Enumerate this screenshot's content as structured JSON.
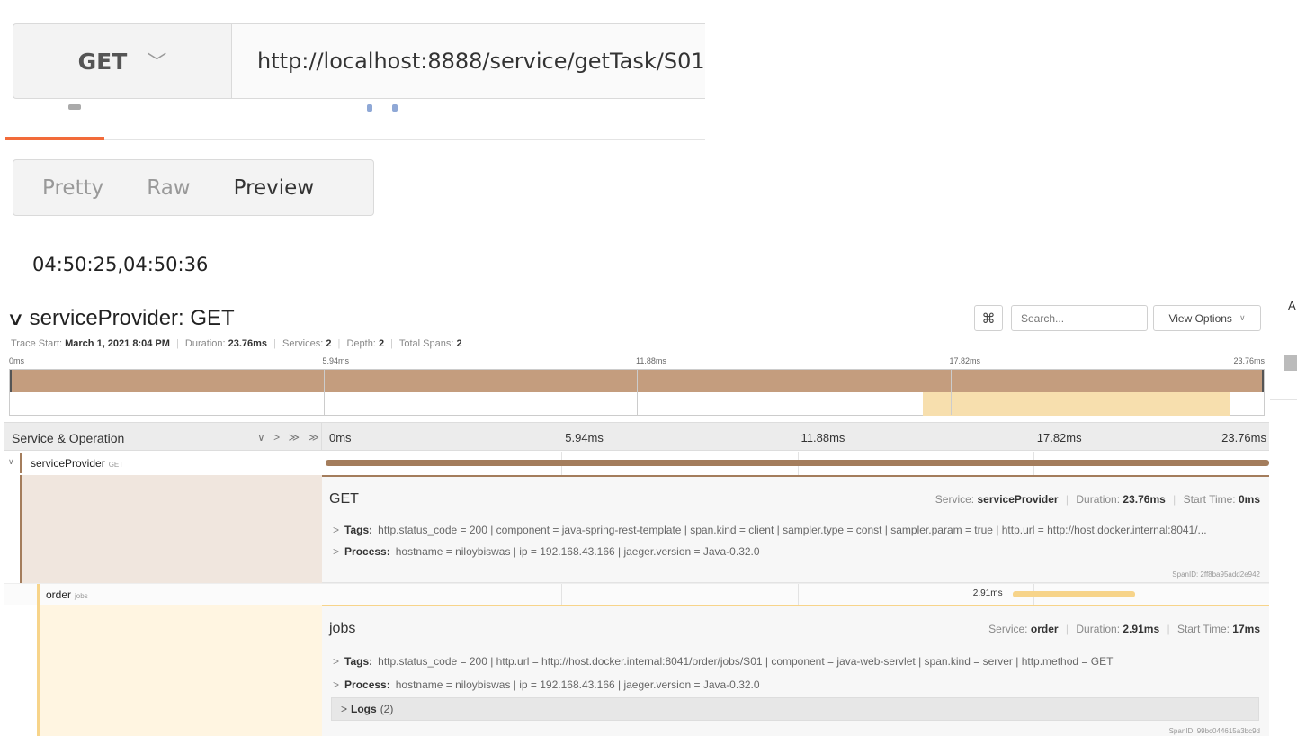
{
  "request": {
    "method": "GET",
    "url": "http://localhost:8888/service/getTask/S01"
  },
  "response": {
    "view_tabs": [
      "Pretty",
      "Raw",
      "Preview"
    ],
    "active_view": "Preview",
    "body": "04:50:25,04:50:36"
  },
  "trace": {
    "title": "serviceProvider: GET",
    "search_placeholder": "Search...",
    "view_options_label": "View Options",
    "keyboard_icon": "⌘",
    "side_label": "A",
    "meta": {
      "trace_start_label": "Trace Start:",
      "trace_start": "March 1, 2021 8:04 PM",
      "duration_label": "Duration:",
      "duration": "23.76ms",
      "services_label": "Services:",
      "services": "2",
      "depth_label": "Depth:",
      "depth": "2",
      "total_spans_label": "Total Spans:",
      "total_spans": "2"
    },
    "ticks": [
      "0ms",
      "5.94ms",
      "11.88ms",
      "17.82ms",
      "23.76ms"
    ],
    "header_label": "Service & Operation",
    "header_controls": "∨ > ≫ ≫",
    "spans": [
      {
        "service": "serviceProvider",
        "operation": "GET",
        "color": "#a47d5c",
        "detail_bg": "#f0e6de",
        "start_ms": 0,
        "duration_ms": 23.76,
        "duration_label": "",
        "service_label": "Service:",
        "duration_text_label": "Duration:",
        "duration_text": "23.76ms",
        "start_label": "Start Time:",
        "start_text": "0ms",
        "tags_label": "Tags:",
        "tags": "http.status_code = 200  |  component = java-spring-rest-template  |  span.kind = client  |  sampler.type = const  |  sampler.param = true  |  http.url = http://host.docker.internal:8041/...",
        "process_label": "Process:",
        "process": "hostname = niloybiswas  |  ip = 192.168.43.166  |  jaeger.version = Java-0.32.0",
        "span_id": "SpanID: 2ff8ba95add2e942"
      },
      {
        "service": "order",
        "operation": "jobs",
        "color": "#f7d48a",
        "detail_bg": "#fff5e1",
        "start_ms": 17.3,
        "duration_ms": 2.91,
        "duration_label": "2.91ms",
        "service_label": "Service:",
        "duration_text_label": "Duration:",
        "duration_text": "2.91ms",
        "start_label": "Start Time:",
        "start_text": "17ms",
        "tags_label": "Tags:",
        "tags": "http.status_code = 200  |  http.url = http://host.docker.internal:8041/order/jobs/S01  |  component = java-web-servlet  |  span.kind = server  |  http.method = GET",
        "process_label": "Process:",
        "process": "hostname = niloybiswas  |  ip = 192.168.43.166  |  jaeger.version = Java-0.32.0",
        "logs_label": "Logs",
        "logs_count": "(2)",
        "span_id": "SpanID: 99bc044615a3bc9d"
      }
    ]
  }
}
